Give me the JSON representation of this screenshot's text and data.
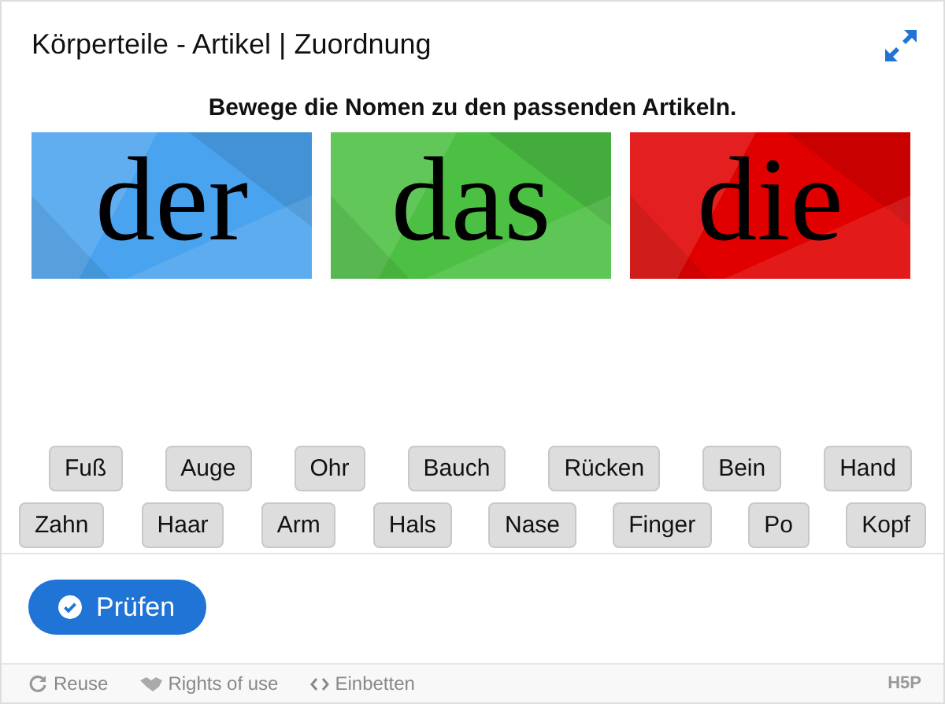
{
  "title": "Körperteile - Artikel | Zuordnung",
  "instruction": "Bewege die Nomen zu den passenden Artikeln.",
  "zones": [
    {
      "label": "der",
      "color": "#4aa3ee"
    },
    {
      "label": "das",
      "color": "#4cc043"
    },
    {
      "label": "die",
      "color": "#e00000"
    }
  ],
  "word_rows": [
    [
      "Fuß",
      "Auge",
      "Ohr",
      "Bauch",
      "Rücken",
      "Bein",
      "Hand"
    ],
    [
      "Zahn",
      "Haar",
      "Arm",
      "Hals",
      "Nase",
      "Finger",
      "Po",
      "Kopf"
    ]
  ],
  "check_button": "Prüfen",
  "footer": {
    "links": [
      {
        "kind": "reuse",
        "label": "Reuse"
      },
      {
        "kind": "rights",
        "label": "Rights of use"
      },
      {
        "kind": "embed",
        "label": "Einbetten"
      }
    ],
    "logo": "H5P"
  }
}
